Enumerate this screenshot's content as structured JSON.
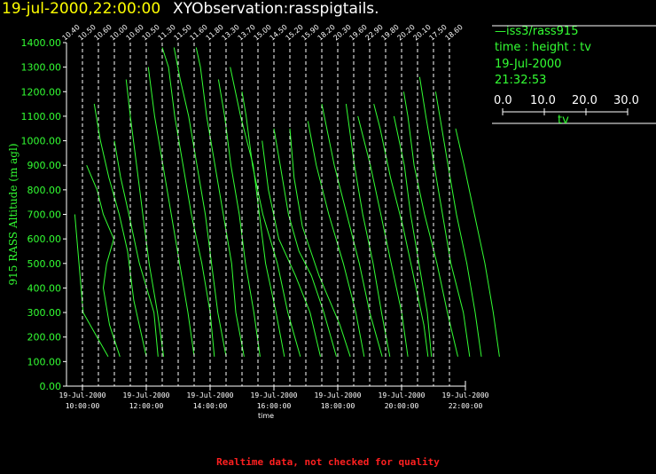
{
  "header": {
    "datetime": "19-jul-2000,22:00:00",
    "observation": "XYObservation:rasspigtails."
  },
  "legend": {
    "series_line": "—iss3/rass915",
    "plot_kind": "time : height : tv",
    "date": "19-Jul-2000",
    "time": "21:32:53",
    "scale_ticks": [
      "0.0",
      "10.0",
      "20.0",
      "30.0"
    ],
    "scale_label": "tv"
  },
  "footer": {
    "notice": "Realtime data, not checked for quality"
  },
  "colors": {
    "background": "#000000",
    "trace": "#33ff33",
    "axis": "#ffffff",
    "title": "#ffff00",
    "notice": "#ff2020"
  },
  "chart_data": {
    "type": "line",
    "title": "19-jul-2000,22:00:00  XYObservation:rasspigtails.",
    "xlabel": "time",
    "ylabel": "915 RASS Altitude (m agl)",
    "x_range_hours": [
      9.5,
      22.0
    ],
    "ylim": [
      0,
      1400
    ],
    "y_ticks": [
      "0.00",
      "100.00",
      "200.00",
      "300.00",
      "400.00",
      "500.00",
      "600.00",
      "700.00",
      "800.00",
      "900.00",
      "1000.00",
      "1100.00",
      "1200.00",
      "1300.00",
      "1400.00"
    ],
    "x_ticks": [
      {
        "hour": 10,
        "date": "19-Jul-2000",
        "time": "10:00:00"
      },
      {
        "hour": 12,
        "date": "19-Jul-2000",
        "time": "12:00:00"
      },
      {
        "hour": 14,
        "date": "19-Jul-2000",
        "time": "14:00:00"
      },
      {
        "hour": 16,
        "date": "19-Jul-2000",
        "time": "16:00:00"
      },
      {
        "hour": 18,
        "date": "19-Jul-2000",
        "time": "18:00:00"
      },
      {
        "hour": 20,
        "date": "19-Jul-2000",
        "time": "20:00:00"
      },
      {
        "hour": 22,
        "date": "19-Jul-2000",
        "time": "22:00:00"
      }
    ],
    "tv_scale_full": 30,
    "profiles": [
      {
        "time": "09:30",
        "hour": 9.5,
        "label": "10.40",
        "points": [
          [
            120,
            10.0
          ],
          [
            300,
            4.0
          ],
          [
            500,
            3.0
          ],
          [
            700,
            2.0
          ]
        ]
      },
      {
        "time": "10:00",
        "hour": 10.0,
        "label": "10.50",
        "points": [
          [
            120,
            9.0
          ],
          [
            250,
            6.5
          ],
          [
            400,
            5.0
          ],
          [
            500,
            5.8
          ],
          [
            600,
            7.5
          ],
          [
            700,
            5.0
          ],
          [
            800,
            3.5
          ],
          [
            900,
            1.0
          ]
        ]
      },
      {
        "time": "10:30",
        "hour": 10.5,
        "label": "10.60",
        "points": [
          [
            120,
            11.5
          ],
          [
            350,
            8.5
          ],
          [
            550,
            7.0
          ],
          [
            700,
            5.0
          ],
          [
            850,
            2.5
          ],
          [
            1000,
            0.5
          ],
          [
            1150,
            -1.0
          ]
        ]
      },
      {
        "time": "11:00",
        "hour": 11.0,
        "label": "10.00",
        "points": [
          [
            120,
            10.5
          ],
          [
            300,
            9.5
          ],
          [
            500,
            6.0
          ],
          [
            700,
            3.5
          ],
          [
            850,
            1.5
          ],
          [
            1000,
            0.0
          ]
        ]
      },
      {
        "time": "11:30",
        "hour": 11.5,
        "label": "10.60",
        "points": [
          [
            120,
            8.0
          ],
          [
            300,
            6.5
          ],
          [
            500,
            4.5
          ],
          [
            700,
            3.0
          ],
          [
            900,
            1.5
          ],
          [
            1100,
            0.0
          ],
          [
            1250,
            -1.0
          ]
        ]
      },
      {
        "time": "12:00",
        "hour": 12.0,
        "label": "10.50",
        "points": [
          [
            120,
            11.5
          ],
          [
            300,
            10.0
          ],
          [
            500,
            8.0
          ],
          [
            700,
            6.0
          ],
          [
            900,
            4.0
          ],
          [
            1100,
            2.0
          ],
          [
            1300,
            0.5
          ]
        ]
      },
      {
        "time": "12:30",
        "hour": 12.5,
        "label": "11.30",
        "points": [
          [
            120,
            12.5
          ],
          [
            300,
            11.5
          ],
          [
            500,
            9.5
          ],
          [
            700,
            7.0
          ],
          [
            900,
            5.0
          ],
          [
            1100,
            3.0
          ],
          [
            1300,
            1.5
          ],
          [
            1380,
            0.0
          ]
        ]
      },
      {
        "time": "13:00",
        "hour": 13.0,
        "label": "11.50",
        "points": [
          [
            120,
            11.5
          ],
          [
            300,
            9.5
          ],
          [
            500,
            8.0
          ],
          [
            700,
            6.5
          ],
          [
            900,
            4.5
          ],
          [
            1100,
            2.5
          ],
          [
            1250,
            0.5
          ],
          [
            1380,
            -1.0
          ]
        ]
      },
      {
        "time": "13:30",
        "hour": 13.5,
        "label": "11.60",
        "points": [
          [
            120,
            12.0
          ],
          [
            300,
            10.0
          ],
          [
            500,
            9.0
          ],
          [
            700,
            7.0
          ],
          [
            900,
            5.0
          ],
          [
            1100,
            3.0
          ],
          [
            1300,
            1.5
          ],
          [
            1380,
            0.5
          ]
        ]
      },
      {
        "time": "14:00",
        "hour": 14.0,
        "label": "11.80",
        "points": [
          [
            120,
            12.0
          ],
          [
            300,
            10.5
          ],
          [
            500,
            8.5
          ],
          [
            700,
            7.0
          ],
          [
            900,
            5.0
          ],
          [
            1100,
            3.5
          ],
          [
            1250,
            2.0
          ]
        ]
      },
      {
        "time": "14:30",
        "hour": 14.5,
        "label": "13.30",
        "points": [
          [
            120,
            14.0
          ],
          [
            300,
            12.0
          ],
          [
            500,
            9.5
          ],
          [
            700,
            8.0
          ],
          [
            900,
            6.5
          ],
          [
            1100,
            3.5
          ],
          [
            1300,
            1.0
          ]
        ]
      },
      {
        "time": "15:00",
        "hour": 15.0,
        "label": "13.70",
        "points": [
          [
            120,
            14.0
          ],
          [
            300,
            11.0
          ],
          [
            500,
            8.5
          ],
          [
            700,
            5.0
          ],
          [
            900,
            2.5
          ],
          [
            1100,
            1.0
          ],
          [
            1200,
            0.0
          ]
        ]
      },
      {
        "time": "15:30",
        "hour": 15.5,
        "label": "15.00",
        "points": [
          [
            120,
            15.0
          ],
          [
            300,
            12.5
          ],
          [
            450,
            9.0
          ],
          [
            600,
            5.0
          ],
          [
            800,
            2.5
          ],
          [
            1000,
            1.0
          ]
        ]
      },
      {
        "time": "16:00",
        "hour": 16.0,
        "label": "14.50",
        "points": [
          [
            120,
            15.0
          ],
          [
            300,
            12.0
          ],
          [
            450,
            9.0
          ],
          [
            550,
            6.0
          ],
          [
            700,
            3.5
          ],
          [
            900,
            1.5
          ],
          [
            1050,
            0.0
          ]
        ]
      },
      {
        "time": "16:30",
        "hour": 16.5,
        "label": "15.20",
        "points": [
          [
            120,
            14.5
          ],
          [
            250,
            12.0
          ],
          [
            450,
            7.0
          ],
          [
            650,
            3.0
          ],
          [
            850,
            1.0
          ],
          [
            1050,
            0.0
          ]
        ]
      },
      {
        "time": "17:00",
        "hour": 17.0,
        "label": "15.90",
        "points": [
          [
            120,
            14.0
          ],
          [
            300,
            12.0
          ],
          [
            500,
            9.0
          ],
          [
            700,
            5.5
          ],
          [
            900,
            2.5
          ],
          [
            1080,
            0.5
          ]
        ]
      },
      {
        "time": "17:30",
        "hour": 17.5,
        "label": "18.20",
        "points": [
          [
            120,
            14.5
          ],
          [
            300,
            11.5
          ],
          [
            500,
            9.0
          ],
          [
            700,
            6.0
          ],
          [
            900,
            3.0
          ],
          [
            1150,
            0.0
          ]
        ]
      },
      {
        "time": "18:00",
        "hour": 18.0,
        "label": "20.30",
        "points": [
          [
            120,
            12.5
          ],
          [
            300,
            10.5
          ],
          [
            500,
            8.5
          ],
          [
            700,
            6.0
          ],
          [
            900,
            4.0
          ],
          [
            1150,
            2.0
          ]
        ]
      },
      {
        "time": "18:30",
        "hour": 18.5,
        "label": "19.60",
        "points": [
          [
            120,
            13.0
          ],
          [
            300,
            11.5
          ],
          [
            500,
            9.0
          ],
          [
            700,
            6.5
          ],
          [
            900,
            4.0
          ],
          [
            1100,
            1.0
          ]
        ]
      },
      {
        "time": "19:00",
        "hour": 19.0,
        "label": "22.90",
        "points": [
          [
            120,
            14.0
          ],
          [
            250,
            13.0
          ],
          [
            450,
            10.5
          ],
          [
            650,
            8.0
          ],
          [
            850,
            5.0
          ],
          [
            1050,
            2.5
          ],
          [
            1150,
            1.0
          ]
        ]
      },
      {
        "time": "19:30",
        "hour": 19.5,
        "label": "19.80",
        "points": [
          [
            120,
            11.0
          ],
          [
            300,
            10.0
          ],
          [
            500,
            8.0
          ],
          [
            700,
            6.0
          ],
          [
            900,
            4.5
          ],
          [
            1100,
            2.0
          ]
        ]
      },
      {
        "time": "20:00",
        "hour": 20.0,
        "label": "20.20",
        "points": [
          [
            120,
            13.5
          ],
          [
            300,
            11.0
          ],
          [
            500,
            8.5
          ],
          [
            700,
            5.5
          ],
          [
            900,
            3.0
          ],
          [
            1100,
            1.5
          ],
          [
            1200,
            0.5
          ]
        ]
      },
      {
        "time": "20:30",
        "hour": 20.5,
        "label": "20.10",
        "points": [
          [
            120,
            12.5
          ],
          [
            300,
            11.0
          ],
          [
            500,
            8.0
          ],
          [
            700,
            6.0
          ],
          [
            900,
            4.0
          ],
          [
            1100,
            2.0
          ],
          [
            1260,
            0.5
          ]
        ]
      },
      {
        "time": "21:00",
        "hour": 21.0,
        "label": "17.50",
        "points": [
          [
            120,
            11.5
          ],
          [
            300,
            10.0
          ],
          [
            500,
            8.0
          ],
          [
            700,
            5.5
          ],
          [
            900,
            3.5
          ],
          [
            1100,
            1.5
          ],
          [
            1200,
            0.5
          ]
        ]
      },
      {
        "time": "21:30",
        "hour": 21.5,
        "label": "18.60",
        "points": [
          [
            120,
            12.0
          ],
          [
            300,
            10.5
          ],
          [
            500,
            8.5
          ],
          [
            700,
            6.0
          ],
          [
            900,
            3.5
          ],
          [
            1050,
            1.5
          ]
        ]
      }
    ]
  }
}
